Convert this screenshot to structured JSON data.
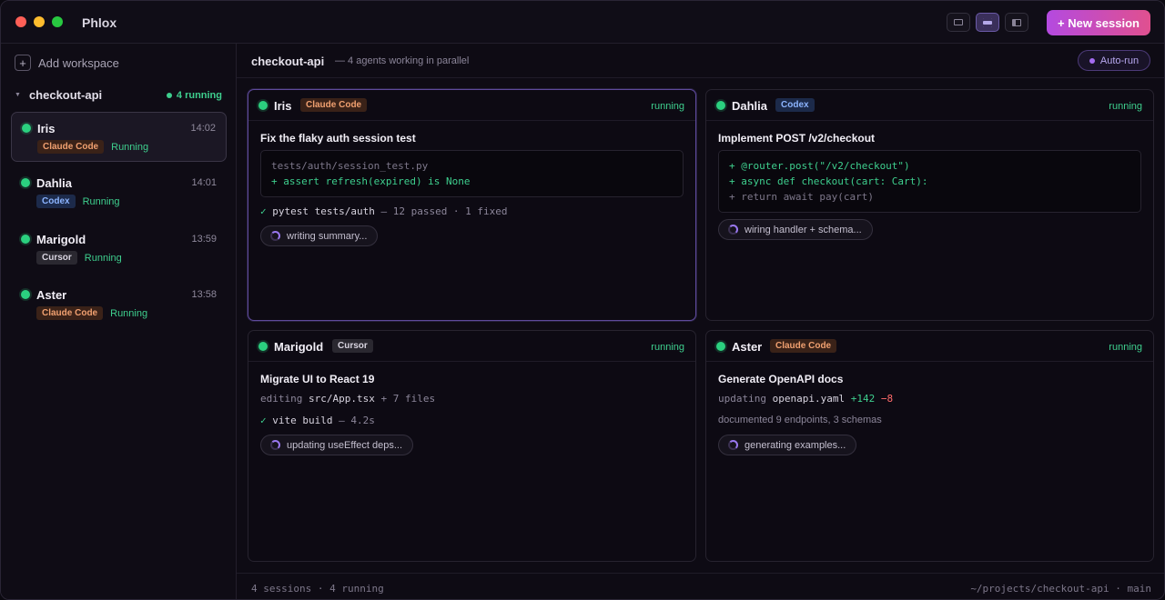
{
  "app": {
    "title": "Phlox",
    "new_session_label": "+ New session"
  },
  "sidebar": {
    "add_workspace_label": "Add workspace",
    "workspace": {
      "name": "checkout-api",
      "running": "4 running"
    },
    "sessions": [
      {
        "name": "Iris",
        "time": "14:02",
        "agent": "Claude Code",
        "status": "Running"
      },
      {
        "name": "Dahlia",
        "time": "14:01",
        "agent": "Codex",
        "status": "Running"
      },
      {
        "name": "Marigold",
        "time": "13:59",
        "agent": "Cursor",
        "status": "Running"
      },
      {
        "name": "Aster",
        "time": "13:58",
        "agent": "Claude Code",
        "status": "Running"
      }
    ]
  },
  "main": {
    "title": "checkout-api",
    "subtitle": "— 4 agents working in parallel",
    "autorun_label": "Auto-run",
    "cards": [
      {
        "name": "Iris",
        "agent": "Claude Code",
        "state": "running",
        "task": "Fix the flaky auth session test",
        "code": [
          "tests/auth/session_test.py",
          "+ assert refresh(expired) is None"
        ],
        "result": {
          "check": "✓",
          "cmd": "pytest tests/auth",
          "detail": " — 12 passed · 1 fixed"
        },
        "activity": "writing summary..."
      },
      {
        "name": "Dahlia",
        "agent": "Codex",
        "state": "running",
        "task": "Implement POST /v2/checkout",
        "code": [
          "+ @router.post(\"/v2/checkout\")",
          "+ async def checkout(cart: Cart):",
          "+ return await pay(cart)"
        ],
        "activity": "wiring handler + schema..."
      },
      {
        "name": "Marigold",
        "agent": "Cursor",
        "state": "running",
        "task": "Migrate UI to React 19",
        "editing": {
          "verb": "editing ",
          "file": "src/App.tsx",
          "more": " + 7 files"
        },
        "result": {
          "check": "✓",
          "cmd": "vite build",
          "detail": " — 4.2s"
        },
        "activity": "updating useEffect deps..."
      },
      {
        "name": "Aster",
        "agent": "Claude Code",
        "state": "running",
        "task": "Generate OpenAPI docs",
        "editing": {
          "verb": "updating ",
          "file": "openapi.yaml",
          "plus": "+142",
          "minus": "−8"
        },
        "note": "documented 9 endpoints, 3 schemas",
        "activity": "generating examples..."
      }
    ]
  },
  "footer": {
    "left": "4 sessions · 4 running",
    "right": "~/projects/checkout-api · main"
  },
  "colors": {
    "accent": "#b44ae0",
    "running": "#3ecf8e",
    "claude": "#f0a070",
    "codex": "#8cb4ff"
  }
}
